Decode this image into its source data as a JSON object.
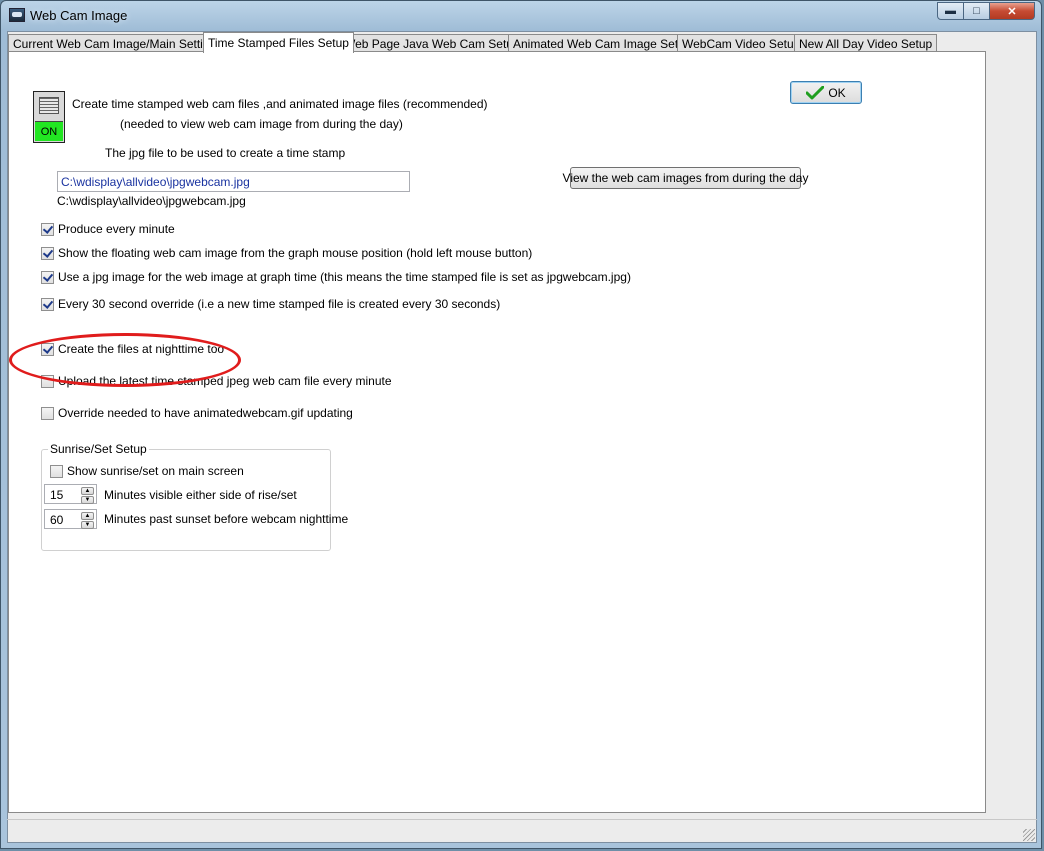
{
  "window": {
    "title": "Web Cam Image",
    "minimize_glyph": "▬",
    "maximize_glyph": "□",
    "close_glyph": "✕"
  },
  "tabs": [
    {
      "label": "Current Web Cam Image/Main Settings",
      "active": false
    },
    {
      "label": "Time Stamped Files Setup",
      "active": true
    },
    {
      "label": "Web Page Java Web Cam Setup",
      "active": false
    },
    {
      "label": "Animated Web Cam Image Setup",
      "active": false
    },
    {
      "label": "WebCam Video Setup",
      "active": false
    },
    {
      "label": "New All Day Video Setup",
      "active": false
    }
  ],
  "main": {
    "switch_label": "ON",
    "create_files_text": "Create time stamped web cam files ,and animated image files (recommended)",
    "needed_text": "(needed to view web cam image from during the day)",
    "ok_label": "OK",
    "jpg_file_label": "The jpg file to be used to create a time stamp",
    "jpg_file_value": "C:\\wdisplay\\allvideo\\jpgwebcam.jpg",
    "jpg_path_display": "C:\\wdisplay\\allvideo\\jpgwebcam.jpg",
    "view_button_label": "View the web cam images from during the day",
    "checkboxes": [
      {
        "label": "Produce every minute",
        "checked": true
      },
      {
        "label": "Show the floating web cam image from the graph mouse position (hold left mouse button)",
        "checked": true
      },
      {
        "label": "Use a jpg image for the web image at graph time (this means the time stamped file is set as jpgwebcam.jpg)",
        "checked": true
      },
      {
        "label": "Every 30 second override (i.e a new time stamped file is created every 30 seconds)",
        "checked": true
      },
      {
        "label": "Create the files at nighttime too",
        "checked": true
      },
      {
        "label": "Upload the latest time stamped jpeg web cam file every minute",
        "checked": false
      },
      {
        "label": "Override needed to have animatedwebcam.gif updating",
        "checked": false
      }
    ],
    "sunrise_group": {
      "legend": "Sunrise/Set Setup",
      "show_checkbox_label": "Show sunrise/set on main screen",
      "show_checked": false,
      "minutes_visible_value": "15",
      "minutes_visible_label": "Minutes visible either side of rise/set",
      "minutes_past_value": "60",
      "minutes_past_label": "Minutes past sunset before webcam nighttime"
    }
  },
  "colors": {
    "switch_on": "#22e622",
    "highlight": "#e01c1c",
    "ok_check": "#1f9e1f"
  }
}
